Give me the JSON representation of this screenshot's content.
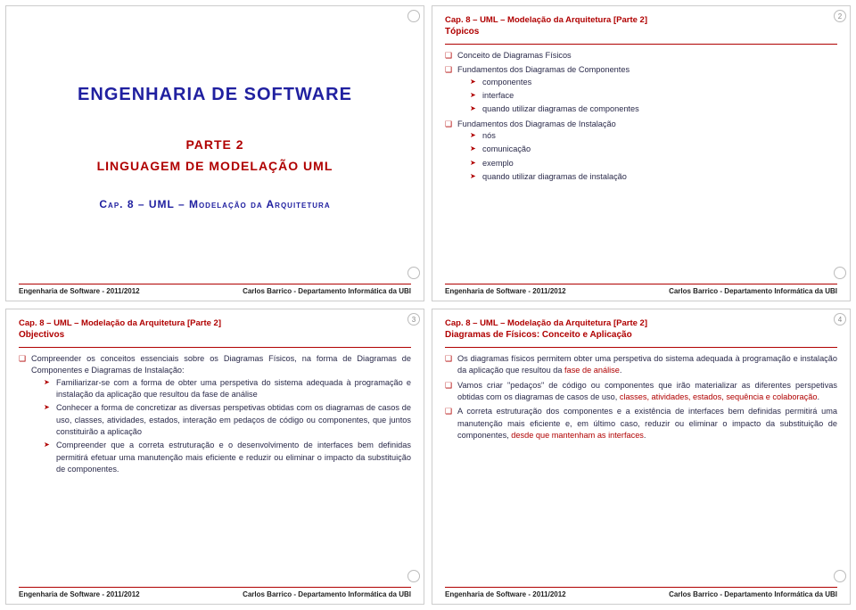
{
  "common": {
    "header_chapter": "Cap. 8 – UML – Modelação da Arquitetura [Parte 2]",
    "footer_left": "Engenharia de Software - 2011/2012",
    "footer_right": "Carlos Barrico - Departamento Informática da UBI"
  },
  "slide1": {
    "title_main": "ENGENHARIA DE SOFTWARE",
    "title_part": "PARTE 2",
    "title_lang": "LINGUAGEM DE MODELAÇÃO UML",
    "title_cap": "Cap. 8 – UML – Modelação da Arquitetura"
  },
  "slide2": {
    "page": "2",
    "subtitle": "Tópicos",
    "items": [
      {
        "text": "Conceito de Diagramas Físicos"
      },
      {
        "text": "Fundamentos dos Diagramas de Componentes",
        "sub": [
          "componentes",
          "interface",
          "quando utilizar diagramas de componentes"
        ]
      },
      {
        "text": "Fundamentos dos Diagramas de Instalação",
        "sub": [
          "nós",
          "comunicação",
          "exemplo",
          "quando utilizar diagramas de instalação"
        ]
      }
    ]
  },
  "slide3": {
    "page": "3",
    "subtitle": "Objectivos",
    "intro": "Compreender os conceitos essenciais sobre os Diagramas Físicos, na forma de Diagramas de Componentes e Diagramas de Instalação:",
    "sub": [
      "Familiarizar-se com a forma de obter uma perspetiva do sistema adequada à programação e instalação da aplicação que resultou da fase de análise",
      "Conhecer a forma de concretizar as diversas perspetivas obtidas com os diagramas de casos de uso, classes, atividades, estados, interação em pedaços de código ou componentes, que juntos constituirão a aplicação",
      "Compreender que a correta estruturação e o desenvolvimento de interfaces bem definidas permitirá efetuar uma manutenção mais eficiente e reduzir ou eliminar o impacto da substituição de componentes."
    ]
  },
  "slide4": {
    "page": "4",
    "subtitle": "Diagramas de Físicos: Conceito e Aplicação",
    "items": [
      {
        "lead": "Os diagramas físicos permitem obter uma perspetiva do sistema adequada à programação e instalação da aplicação que resultou da ",
        "red": "fase de análise",
        "tail": "."
      },
      {
        "lead": "Vamos criar \"pedaços\" de código ou componentes que irão materializar as diferentes perspetivas obtidas com os diagramas de casos de uso, ",
        "red": "classes, atividades, estados, sequência e colaboração",
        "tail": "."
      },
      {
        "lead": "A correta estruturação dos componentes e a existência de interfaces bem definidas permitirá uma manutenção mais eficiente e, em último caso, reduzir ou eliminar o impacto da substituição de componentes, ",
        "red": "desde que mantenham as interfaces",
        "tail": "."
      }
    ]
  }
}
